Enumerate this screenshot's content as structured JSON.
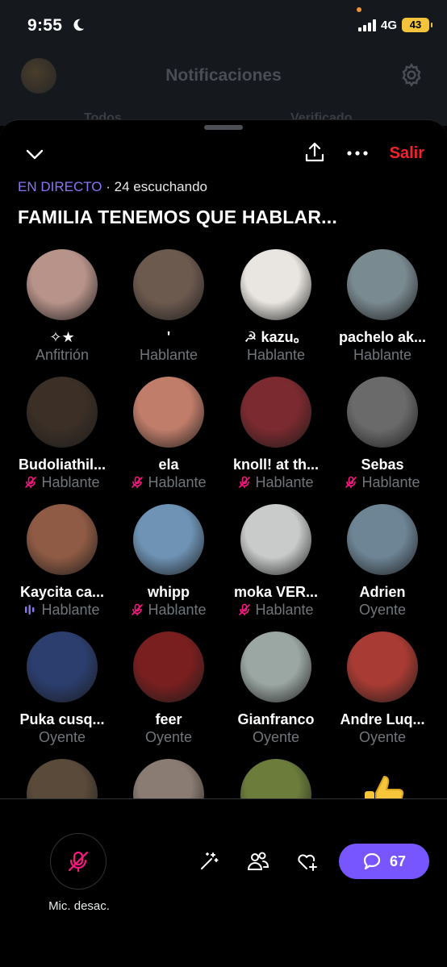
{
  "status_bar": {
    "time": "9:55",
    "network": "4G",
    "battery": "43"
  },
  "background": {
    "title": "Notificaciones",
    "tab_left": "Todos",
    "tab_right": "Verificado"
  },
  "space": {
    "exit_label": "Salir",
    "live_tag": "EN DIRECTO",
    "listeners": "· 24 escuchando",
    "title": "FAMILIA TENEMOS QUE HABLAR..."
  },
  "participants": [
    {
      "name": "✧★",
      "role": "Anfitrión",
      "mic": "none",
      "color": "#b8938a"
    },
    {
      "name": "'",
      "role": "Hablante",
      "mic": "none",
      "color": "#6d5a4f"
    },
    {
      "name": "☭ kazu。",
      "role": "Hablante",
      "mic": "none",
      "color": "#e9e6e1"
    },
    {
      "name": "pachelo ak...",
      "role": "Hablante",
      "mic": "none",
      "color": "#7a8a91"
    },
    {
      "name": "Budoliathil...",
      "role": "Hablante",
      "mic": "muted",
      "color": "#3b2f26"
    },
    {
      "name": "ela",
      "role": "Hablante",
      "mic": "muted",
      "color": "#c07d6a"
    },
    {
      "name": "knoll! at th...",
      "role": "Hablante",
      "mic": "muted",
      "color": "#7b2a2f"
    },
    {
      "name": "Sebas",
      "role": "Hablante",
      "mic": "muted",
      "color": "#6a6a6a"
    },
    {
      "name": "Kaycita ca...",
      "role": "Hablante",
      "mic": "speaking",
      "color": "#8f5b44"
    },
    {
      "name": "whipp",
      "role": "Hablante",
      "mic": "muted",
      "color": "#6e93b5"
    },
    {
      "name": "moka VER...",
      "role": "Hablante",
      "mic": "muted",
      "color": "#c8cbc9"
    },
    {
      "name": "Adrien",
      "role": "Oyente",
      "mic": "none",
      "color": "#6e8596"
    },
    {
      "name": "Puka cusq...",
      "role": "Oyente",
      "mic": "none",
      "color": "#2b3e6e"
    },
    {
      "name": "feer",
      "role": "Oyente",
      "mic": "none",
      "color": "#7a1f1f"
    },
    {
      "name": "Gianfranco",
      "role": "Oyente",
      "mic": "none",
      "color": "#9ba7a3"
    },
    {
      "name": "Andre Luq...",
      "role": "Oyente",
      "mic": "none",
      "color": "#a83b33"
    },
    {
      "name": "",
      "role": "",
      "mic": "none",
      "color": "#5a4a3a"
    },
    {
      "name": "",
      "role": "",
      "mic": "none",
      "color": "#8a7c72"
    },
    {
      "name": "",
      "role": "",
      "mic": "none",
      "color": "#6b7c3b"
    },
    {
      "name": "",
      "role": "",
      "mic": "none",
      "color": "emoji"
    }
  ],
  "bottom_bar": {
    "mic_label": "Mic. desac.",
    "comments_count": "67"
  },
  "colors": {
    "accent": "#7856ff",
    "exit": "#f4212e",
    "muted": "#f91880",
    "live": "#8b74f6"
  },
  "icons": [
    "chevron-down-icon",
    "share-icon",
    "more-icon",
    "mic-off-icon",
    "magic-wand-icon",
    "people-icon",
    "heart-plus-icon",
    "comment-icon"
  ]
}
